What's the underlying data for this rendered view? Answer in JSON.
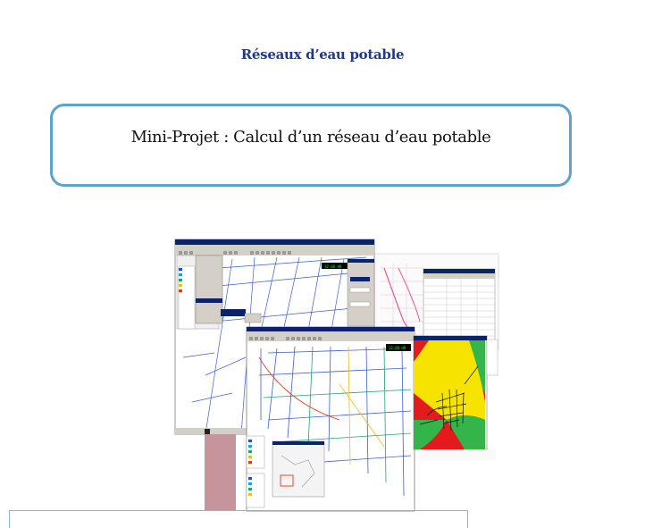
{
  "document": {
    "header_title": "Réseaux d’eau potable",
    "project_title": "Mini-Projet : Calcul d’un réseau d’eau potable"
  },
  "figure": {
    "icon": "network-map-collage",
    "colors": {
      "heatmap_red": "#e41a1c",
      "heatmap_yellow": "#f6e400",
      "heatmap_green": "#33b54a",
      "window_titlebar": "#0a246a",
      "window_chrome": "#d4d0c8",
      "swatch_pink": "#c6959b"
    }
  }
}
